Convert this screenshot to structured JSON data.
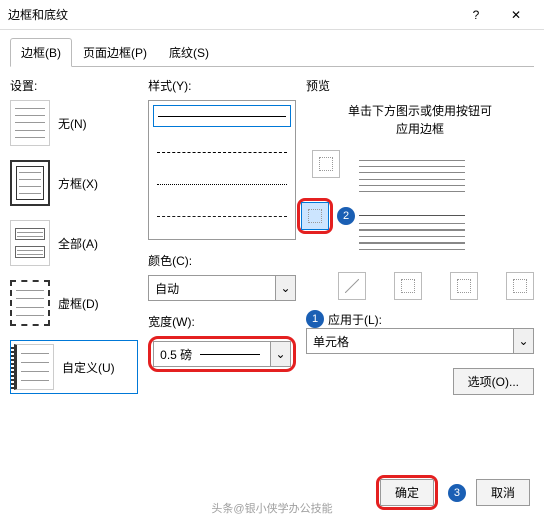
{
  "window": {
    "title": "边框和底纹"
  },
  "tabs": {
    "border": "边框(B)",
    "page_border": "页面边框(P)",
    "shading": "底纹(S)"
  },
  "settings": {
    "label": "设置:",
    "none": "无(N)",
    "box": "方框(X)",
    "all": "全部(A)",
    "dashed": "虚框(D)",
    "custom": "自定义(U)"
  },
  "style": {
    "label": "样式(Y):"
  },
  "color": {
    "label": "颜色(C):",
    "value": "自动"
  },
  "width": {
    "label": "宽度(W):",
    "value": "0.5 磅"
  },
  "preview": {
    "label": "预览",
    "hint_line1": "单击下方图示或使用按钮可",
    "hint_line2": "应用边框"
  },
  "apply": {
    "label": "应用于(L):",
    "value": "单元格"
  },
  "options_btn": "选项(O)...",
  "ok": "确定",
  "cancel": "取消",
  "markers": {
    "m1": "1",
    "m2": "2",
    "m3": "3"
  },
  "watermark": "头条@银小侠学办公技能"
}
